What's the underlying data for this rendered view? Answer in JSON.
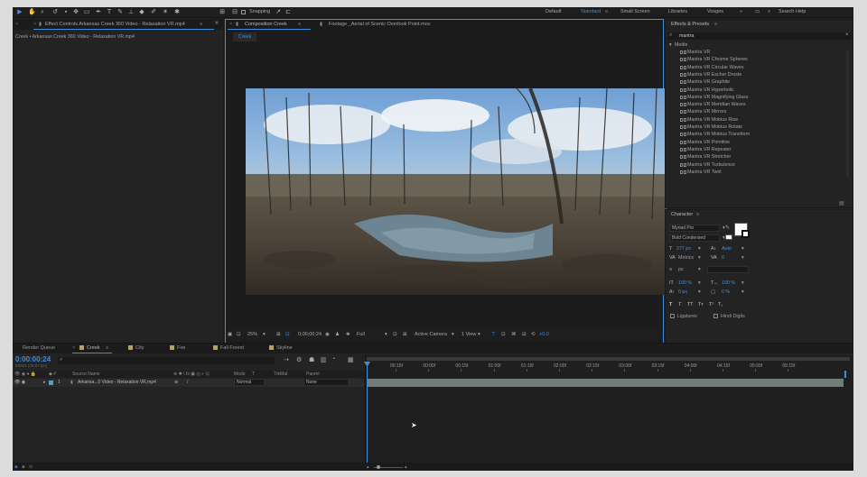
{
  "workspaces": [
    "Default",
    "Standard",
    "Small Screen",
    "Libraries",
    "Vosges"
  ],
  "workspace_active": "Standard",
  "search_help": "Search Help",
  "snapping_label": "Snapping",
  "left_panel": {
    "tab_label": "Effect Controls Arkansas Creek 360 Video - Relaxation VR.mp4",
    "subtitle": "Creek • Arkansas Creek 360 Video - Relaxation VR.mp4"
  },
  "composition": {
    "tab_label": "Composition Creek",
    "footage_tab": "Footage _Aerial of Scenic Overlook Point.mov",
    "breadcrumb": "Creek",
    "zoom": "25%",
    "timecode": "0;00;00;24",
    "resolution": "Full",
    "camera": "Active Camera",
    "views": "1 View",
    "exposure": "+0.0"
  },
  "effects": {
    "title": "Effects & Presets",
    "search_value": "mantra",
    "category": "Mettle",
    "items": [
      "Mantra VR",
      "Mantra VR Chrome Spheres",
      "Mantra VR Circular Waves",
      "Mantra VR Escher Droste",
      "Mantra VR Graphite",
      "Mantra VR Hyperbolic",
      "Mantra VR Magnifying Glass",
      "Mantra VR Meridian Waves",
      "Mantra VR Mirrors",
      "Mantra VR Mobius Row",
      "Mantra VR Mobius Rotate",
      "Mantra VR Mobius Transform",
      "Mantra VR Primitive",
      "Mantra VR Repeater",
      "Mantra VR Stretcher",
      "Mantra VR Turbulence",
      "Mantra VR Twirl"
    ]
  },
  "character": {
    "title": "Character",
    "font": "Myriad Pro",
    "style": "Bold Condensed",
    "size": "277 px",
    "leading": "Auto",
    "kerning": "Metrics",
    "tracking": "0",
    "stroke_width": "px",
    "v_scale": "100 %",
    "h_scale": "100 %",
    "baseline": "0 px",
    "tsume": "0 %",
    "style_buttons": [
      "T",
      "T",
      "TT",
      "Tт",
      "T¹",
      "T₁"
    ],
    "ligatures": "Ligatures",
    "hindi_digits": "Hindi Digits"
  },
  "timeline": {
    "tabs": [
      {
        "label": "Render Queue",
        "color": ""
      },
      {
        "label": "Creek",
        "color": "#b8a06a"
      },
      {
        "label": "City",
        "color": "#b8a06a"
      },
      {
        "label": "Fire",
        "color": "#b8a06a"
      },
      {
        "label": "Fall Forest",
        "color": "#b8a06a"
      },
      {
        "label": "Skyline",
        "color": "#b8a06a"
      }
    ],
    "current_time": "0:00:00:24",
    "fps_note": "00024 (29.97 fps)",
    "columns": {
      "source_name": "Source Name",
      "mode": "Mode",
      "trkmat": "TrkMat",
      "parent": "Parent"
    },
    "ruler": [
      "00:15f",
      "00:00f",
      "00:15f",
      "01:00f",
      "01:15f",
      "02:00f",
      "02:15f",
      "03:00f",
      "03:15f",
      "04:00f",
      "04:15f",
      "05:00f",
      "05:15f"
    ],
    "layers": [
      {
        "num": "1",
        "name": "Arkansa...0 Video - Relaxation VR.mp4",
        "mode": "Normal",
        "parent": "None"
      }
    ]
  },
  "colors": {
    "accent": "#3e8ddd",
    "panel_bg": "#232323",
    "timeline_bar": "#6f7d76"
  }
}
